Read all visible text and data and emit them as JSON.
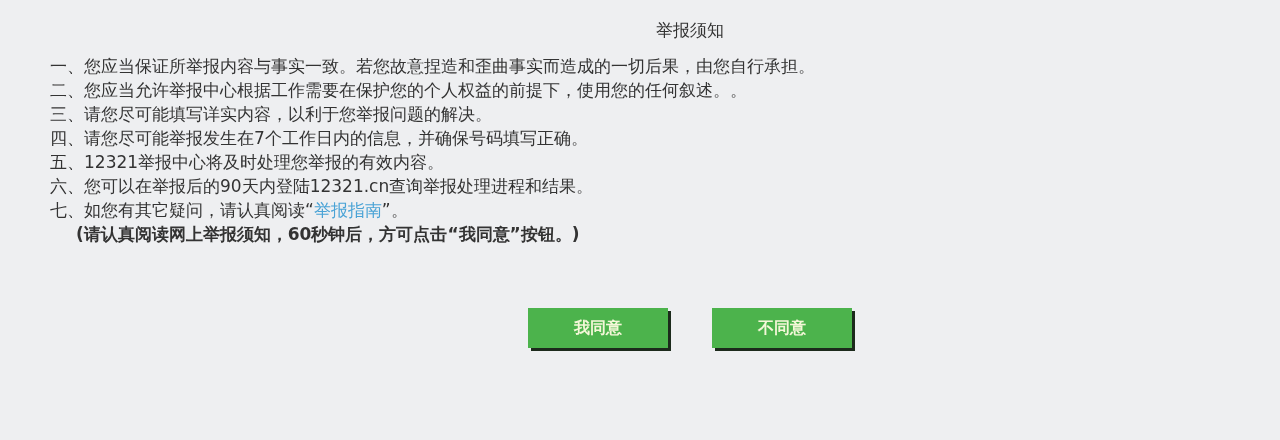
{
  "title": "举报须知",
  "items": [
    {
      "text": "一、您应当保证所举报内容与事实一致。若您故意捏造和歪曲事实而造成的一切后果，由您自行承担。"
    },
    {
      "text": "二、您应当允许举报中心根据工作需要在保护您的个人权益的前提下，使用您的任何叙述。。"
    },
    {
      "text": "三、请您尽可能填写详实内容，以利于您举报问题的解决。"
    },
    {
      "text": "四、请您尽可能举报发生在7个工作日内的信息，并确保号码填写正确。"
    },
    {
      "text": "五、12321举报中心将及时处理您举报的有效内容。"
    },
    {
      "text": "六、您可以在举报后的90天内登陆12321.cn查询举报处理进程和结果。"
    },
    {
      "text": "七、如您有其它疑问，请认真阅读“",
      "link": "举报指南",
      "after": "”。"
    }
  ],
  "note": "(请认真阅读网上举报须知，60秒钟后，方可点击“我同意”按钮。)",
  "buttons": [
    {
      "label": "我同意"
    },
    {
      "label": "不同意"
    }
  ]
}
